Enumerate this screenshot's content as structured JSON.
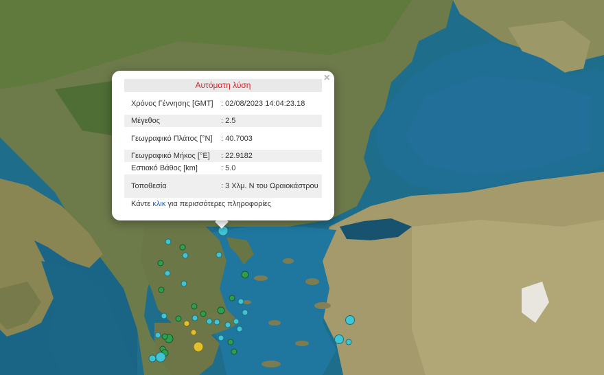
{
  "popup": {
    "title": "Αυτόματη λύση",
    "close_symbol": "×",
    "rows": [
      {
        "label": "Χρόνος Γέννησης [GMT]",
        "value": ": 02/08/2023 14:04:23.18"
      },
      {
        "label": "Μέγεθος",
        "value": ": 2.5"
      },
      {
        "label": "Γεωγραφικό Πλάτος [°N]",
        "value": ": 40.7003"
      },
      {
        "label": "Γεωγραφικό Μήκος [°E]",
        "value": ": 22.9182"
      },
      {
        "label": "Εστιακό Βάθος [km]",
        "value": ": 5.0"
      },
      {
        "label": "Τοποθεσία",
        "value": ": 3 Χλμ. Ν του Ωραιοκάστρου"
      }
    ],
    "more_prefix": "Κάντε ",
    "more_link": "κλικ",
    "more_suffix": " για περισσότερες πληροφορίες"
  },
  "colors": {
    "sea": "#1f6e8c",
    "land": "#6f7a4e",
    "quake_cyan": "#3fc6d6",
    "quake_green": "#2f9e4f",
    "quake_yellow": "#e2c12f",
    "title_red": "#d8262c",
    "link_blue": "#1f5fbf"
  }
}
